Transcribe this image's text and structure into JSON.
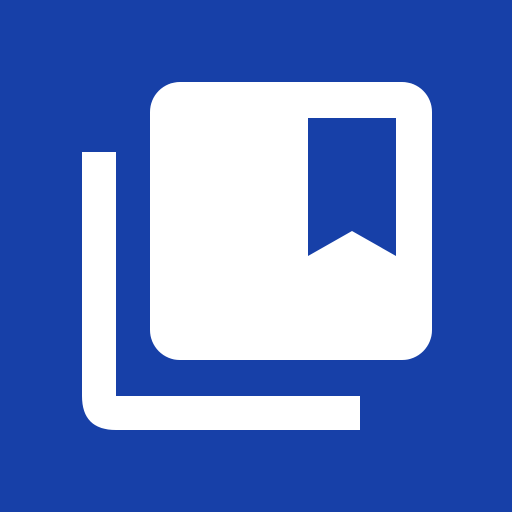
{
  "icon": {
    "name": "library-books-bookmark-icon",
    "background_color": "#1740A8",
    "foreground_color": "#FFFFFF"
  }
}
